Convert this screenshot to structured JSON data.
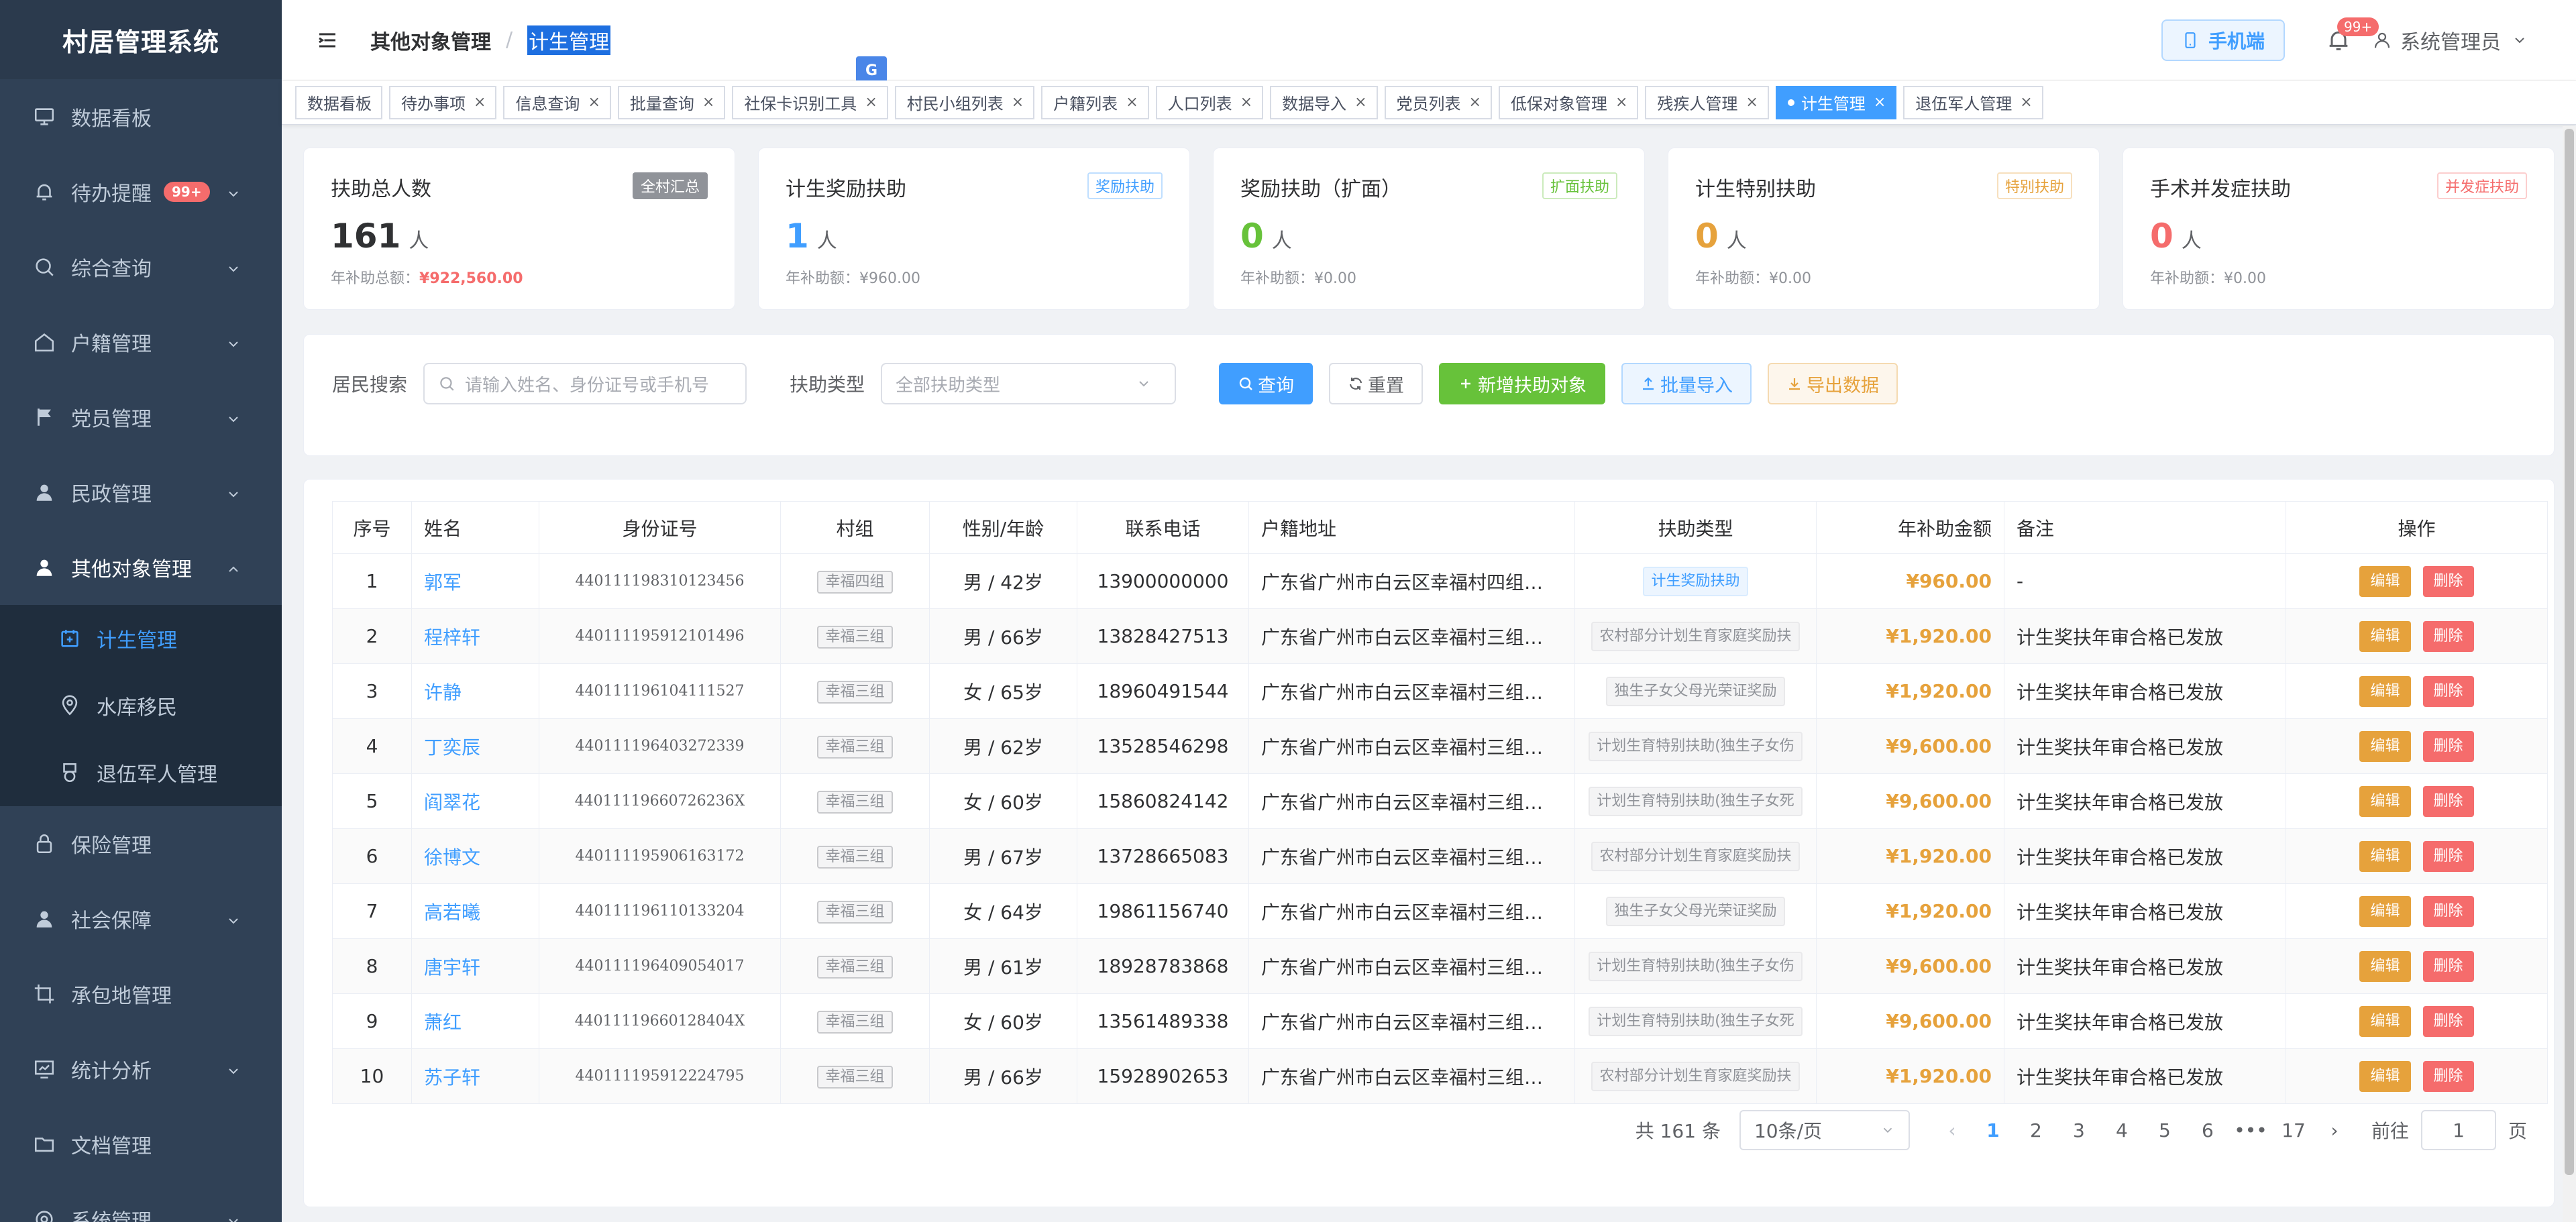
{
  "app": {
    "title": "村居管理系统"
  },
  "sidebar": {
    "items": [
      {
        "label": "数据看板",
        "icon": "monitor-icon"
      },
      {
        "label": "待办提醒",
        "icon": "bell-icon",
        "badge": "99+"
      },
      {
        "label": "综合查询",
        "icon": "search-icon"
      },
      {
        "label": "户籍管理",
        "icon": "house-icon"
      },
      {
        "label": "党员管理",
        "icon": "flag-icon"
      },
      {
        "label": "民政管理",
        "icon": "user-icon"
      },
      {
        "label": "其他对象管理",
        "icon": "user-icon"
      },
      {
        "label": "保险管理",
        "icon": "lock-icon"
      },
      {
        "label": "社会保障",
        "icon": "user-icon"
      },
      {
        "label": "承包地管理",
        "icon": "crop-icon"
      },
      {
        "label": "统计分析",
        "icon": "chart-icon"
      },
      {
        "label": "文档管理",
        "icon": "folder-icon"
      },
      {
        "label": "系统管理",
        "icon": "setting-icon"
      }
    ],
    "submenu": [
      {
        "label": "计生管理",
        "icon": "calendar-plus-icon"
      },
      {
        "label": "水库移民",
        "icon": "location-icon"
      },
      {
        "label": "退伍军人管理",
        "icon": "medal-icon"
      }
    ]
  },
  "header": {
    "breadcrumb_parent": "其他对象管理",
    "breadcrumb_sep": "/",
    "breadcrumb_current": "计生管理",
    "translate_badge": "G",
    "mobile_label": "手机端",
    "notify_count": "99+",
    "user_name": "系统管理员"
  },
  "tags": [
    "数据看板",
    "待办事项",
    "信息查询",
    "批量查询",
    "社保卡识别工具",
    "村民小组列表",
    "户籍列表",
    "人口列表",
    "数据导入",
    "党员列表",
    "低保对象管理",
    "残疾人管理",
    "计生管理",
    "退伍军人管理"
  ],
  "tags_close_glyph": "×",
  "stats": [
    {
      "title": "扶助总人数",
      "tag": "全村汇总",
      "value": "161",
      "unit": "人",
      "sub_label": "年补助总额：",
      "sub_value": "¥922,560.00",
      "color": "#303133",
      "tag_color": "#909399"
    },
    {
      "title": "计生奖励扶助",
      "tag": "奖励扶助",
      "value": "1",
      "unit": "人",
      "sub_label": "年补助额：",
      "sub_value": "¥960.00",
      "color": "#409eff",
      "tag_color": "#409eff"
    },
    {
      "title": "奖励扶助（扩面）",
      "tag": "扩面扶助",
      "value": "0",
      "unit": "人",
      "sub_label": "年补助额：",
      "sub_value": "¥0.00",
      "color": "#67c23a",
      "tag_color": "#67c23a"
    },
    {
      "title": "计生特别扶助",
      "tag": "特别扶助",
      "value": "0",
      "unit": "人",
      "sub_label": "年补助额：",
      "sub_value": "¥0.00",
      "color": "#e6a23c",
      "tag_color": "#e6a23c"
    },
    {
      "title": "手术并发症扶助",
      "tag": "并发症扶助",
      "value": "0",
      "unit": "人",
      "sub_label": "年补助额：",
      "sub_value": "¥0.00",
      "color": "#f56c6c",
      "tag_color": "#f56c6c"
    }
  ],
  "search": {
    "resident_label": "居民搜索",
    "resident_placeholder": "请输入姓名、身份证号或手机号",
    "type_label": "扶助类型",
    "type_placeholder": "全部扶助类型",
    "query_btn": "查询",
    "reset_btn": "重置",
    "add_btn": "新增扶助对象",
    "import_btn": "批量导入",
    "export_btn": "导出数据"
  },
  "table": {
    "headers": [
      "序号",
      "姓名",
      "身份证号",
      "村组",
      "性别/年龄",
      "联系电话",
      "户籍地址",
      "扶助类型",
      "年补助金额",
      "备注",
      "操作"
    ],
    "edit_label": "编辑",
    "delete_label": "删除",
    "rows": [
      {
        "no": "1",
        "name": "郭军",
        "id": "440111198310123456",
        "group": "幸福四组",
        "gender_age": "男 / 42岁",
        "phone": "13900000000",
        "address": "广东省广州市白云区幸福村四组…",
        "type": "计生奖励扶助",
        "type_primary": true,
        "amount": "¥960.00",
        "remark": "-"
      },
      {
        "no": "2",
        "name": "程梓轩",
        "id": "440111195912101496",
        "group": "幸福三组",
        "gender_age": "男 / 66岁",
        "phone": "13828427513",
        "address": "广东省广州市白云区幸福村三组…",
        "type": "农村部分计划生育家庭奖励扶",
        "type_primary": false,
        "amount": "¥1,920.00",
        "remark": "计生奖扶年审合格已发放"
      },
      {
        "no": "3",
        "name": "许静",
        "id": "440111196104111527",
        "group": "幸福三组",
        "gender_age": "女 / 65岁",
        "phone": "18960491544",
        "address": "广东省广州市白云区幸福村三组…",
        "type": "独生子女父母光荣证奖励",
        "type_primary": false,
        "amount": "¥1,920.00",
        "remark": "计生奖扶年审合格已发放"
      },
      {
        "no": "4",
        "name": "丁奕辰",
        "id": "440111196403272339",
        "group": "幸福三组",
        "gender_age": "男 / 62岁",
        "phone": "13528546298",
        "address": "广东省广州市白云区幸福村三组…",
        "type": "计划生育特别扶助(独生子女伤",
        "type_primary": false,
        "amount": "¥9,600.00",
        "remark": "计生奖扶年审合格已发放"
      },
      {
        "no": "5",
        "name": "阎翠花",
        "id": "44011119660726236X",
        "group": "幸福三组",
        "gender_age": "女 / 60岁",
        "phone": "15860824142",
        "address": "广东省广州市白云区幸福村三组…",
        "type": "计划生育特别扶助(独生子女死",
        "type_primary": false,
        "amount": "¥9,600.00",
        "remark": "计生奖扶年审合格已发放"
      },
      {
        "no": "6",
        "name": "徐博文",
        "id": "440111195906163172",
        "group": "幸福三组",
        "gender_age": "男 / 67岁",
        "phone": "13728665083",
        "address": "广东省广州市白云区幸福村三组…",
        "type": "农村部分计划生育家庭奖励扶",
        "type_primary": false,
        "amount": "¥1,920.00",
        "remark": "计生奖扶年审合格已发放"
      },
      {
        "no": "7",
        "name": "高若曦",
        "id": "440111196110133204",
        "group": "幸福三组",
        "gender_age": "女 / 64岁",
        "phone": "19861156740",
        "address": "广东省广州市白云区幸福村三组…",
        "type": "独生子女父母光荣证奖励",
        "type_primary": false,
        "amount": "¥1,920.00",
        "remark": "计生奖扶年审合格已发放"
      },
      {
        "no": "8",
        "name": "唐宇轩",
        "id": "440111196409054017",
        "group": "幸福三组",
        "gender_age": "男 / 61岁",
        "phone": "18928783868",
        "address": "广东省广州市白云区幸福村三组…",
        "type": "计划生育特别扶助(独生子女伤",
        "type_primary": false,
        "amount": "¥9,600.00",
        "remark": "计生奖扶年审合格已发放"
      },
      {
        "no": "9",
        "name": "萧红",
        "id": "44011119660128404X",
        "group": "幸福三组",
        "gender_age": "女 / 60岁",
        "phone": "13561489338",
        "address": "广东省广州市白云区幸福村三组…",
        "type": "计划生育特别扶助(独生子女死",
        "type_primary": false,
        "amount": "¥9,600.00",
        "remark": "计生奖扶年审合格已发放"
      },
      {
        "no": "10",
        "name": "苏子轩",
        "id": "440111195912224795",
        "group": "幸福三组",
        "gender_age": "男 / 66岁",
        "phone": "15928902653",
        "address": "广东省广州市白云区幸福村三组…",
        "type": "农村部分计划生育家庭奖励扶",
        "type_primary": false,
        "amount": "¥1,920.00",
        "remark": "计生奖扶年审合格已发放"
      }
    ]
  },
  "pagination": {
    "total": "共 161 条",
    "page_size": "10条/页",
    "pages": [
      "1",
      "2",
      "3",
      "4",
      "5",
      "6",
      "•••",
      "17"
    ],
    "current": "1",
    "prev_glyph": "‹",
    "next_glyph": "›",
    "goto_label": "前往",
    "goto_value": "1",
    "goto_suffix": "页"
  },
  "colors": {
    "sidebar_bg": "#304156",
    "primary": "#409eff",
    "success": "#67c23a",
    "warning": "#e6a23c",
    "danger": "#f56c6c"
  }
}
